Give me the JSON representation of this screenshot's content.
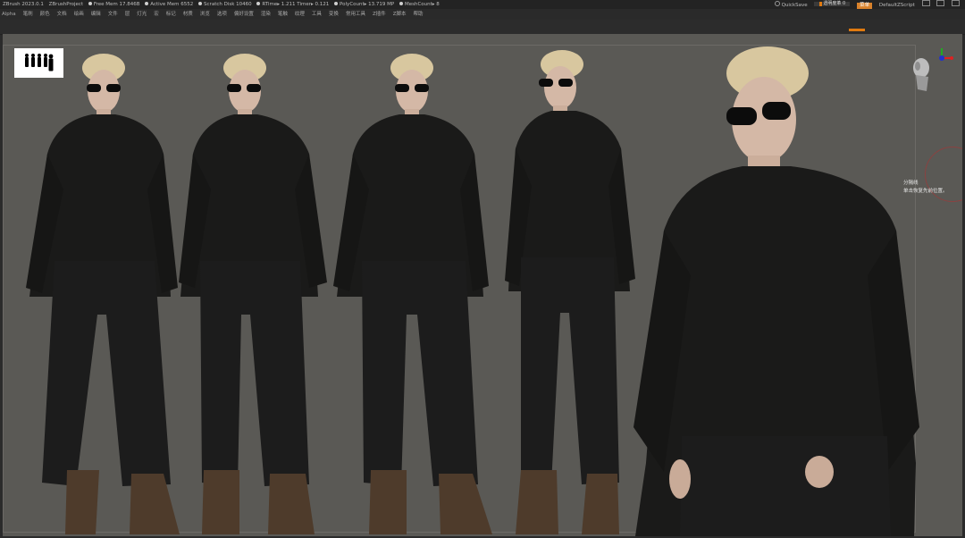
{
  "titlebar": {
    "app_version": "ZBrush 2023.0.1",
    "project": "ZBrushProject",
    "stats": [
      "Free Mem 17.846B",
      "Active Mem 6552",
      "Scratch Disk 10460",
      "RTime▸ 1.211 Timer▸ 0.121",
      "PolyCount▸ 13.719 MP",
      "MeshCount▸ 8"
    ],
    "quicksave": "QuickSave",
    "slider_label": "透明度革 0",
    "slider_value": 0.06,
    "menus_button": "菜单",
    "script": "DefaultZScript"
  },
  "menubar": {
    "items": [
      "Alpha",
      "笔刷",
      "颜色",
      "文档",
      "绘画",
      "编辑",
      "文件",
      "层",
      "灯光",
      "宏",
      "标记",
      "材质",
      "浏览",
      "选项",
      "偏好设置",
      "渲染",
      "笔触",
      "纹理",
      "工具",
      "变换",
      "常用工具",
      "Z插件",
      "Z脚本",
      "帮助"
    ]
  },
  "tooltip": {
    "line1": "分隔线",
    "line2": "单击恢复先前位置。"
  },
  "colors": {
    "accent": "#e07a10",
    "canvas_bg": "#5a5955",
    "sweater": "#1a1a19",
    "pants": "#1c1c1c",
    "boots": "#4e3b2b",
    "skin": "#d4b8a6",
    "hair": "#d8c79f"
  },
  "icons": {
    "head_navigator": "head-navigator-icon",
    "axis_gizmo": "axis-gizmo-icon"
  }
}
